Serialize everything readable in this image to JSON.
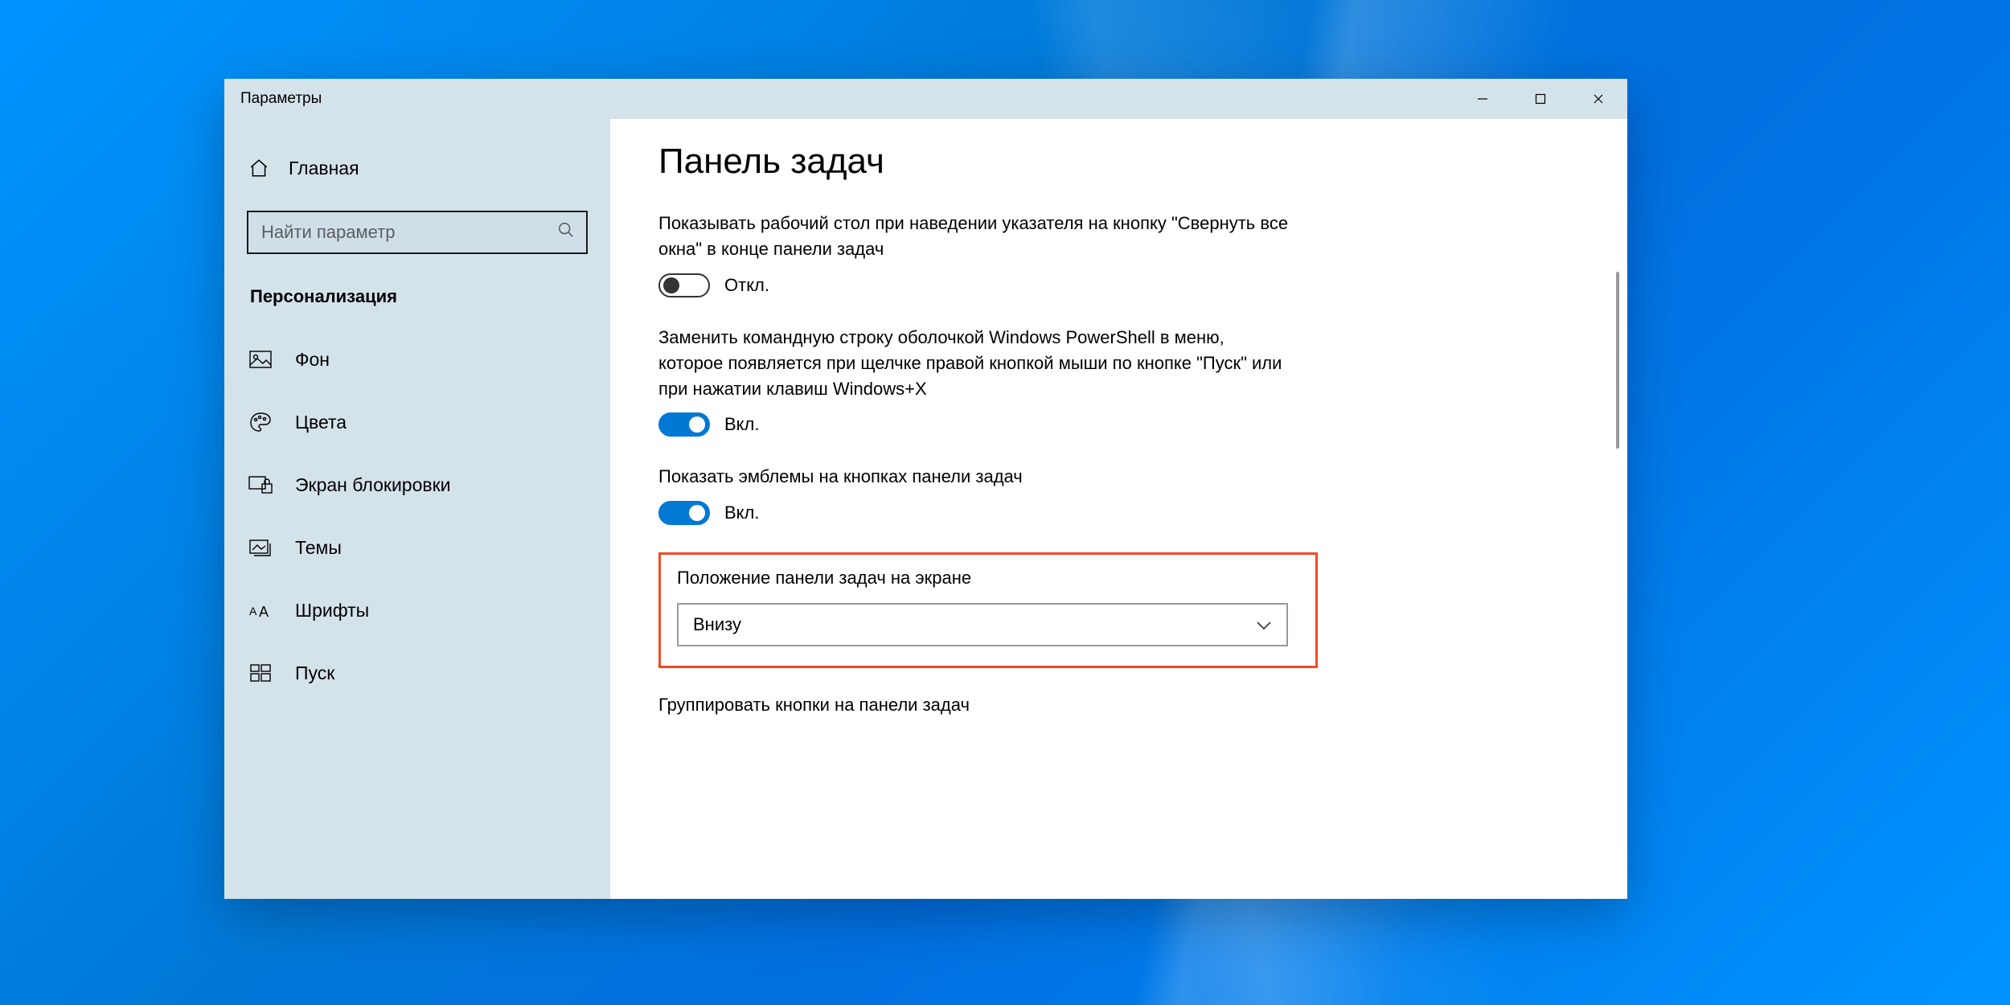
{
  "window": {
    "title": "Параметры"
  },
  "sidebar": {
    "home_label": "Главная",
    "search_placeholder": "Найти параметр",
    "section": "Персонализация",
    "items": [
      {
        "label": "Фон"
      },
      {
        "label": "Цвета"
      },
      {
        "label": "Экран блокировки"
      },
      {
        "label": "Темы"
      },
      {
        "label": "Шрифты"
      },
      {
        "label": "Пуск"
      }
    ]
  },
  "content": {
    "page_title": "Панель задач",
    "setting1_text": "Показывать рабочий стол при наведении указателя на кнопку \"Свернуть все окна\" в конце панели задач",
    "setting1_state": "Откл.",
    "setting2_text": "Заменить командную строку оболочкой Windows PowerShell в меню, которое появляется при щелчке правой кнопкой мыши по кнопке \"Пуск\" или при нажатии клавиш Windows+X",
    "setting2_state": "Вкл.",
    "setting3_text": "Показать эмблемы на кнопках панели задач",
    "setting3_state": "Вкл.",
    "position_label": "Положение панели задач на экране",
    "position_value": "Внизу",
    "group_label": "Группировать кнопки на панели задач"
  }
}
